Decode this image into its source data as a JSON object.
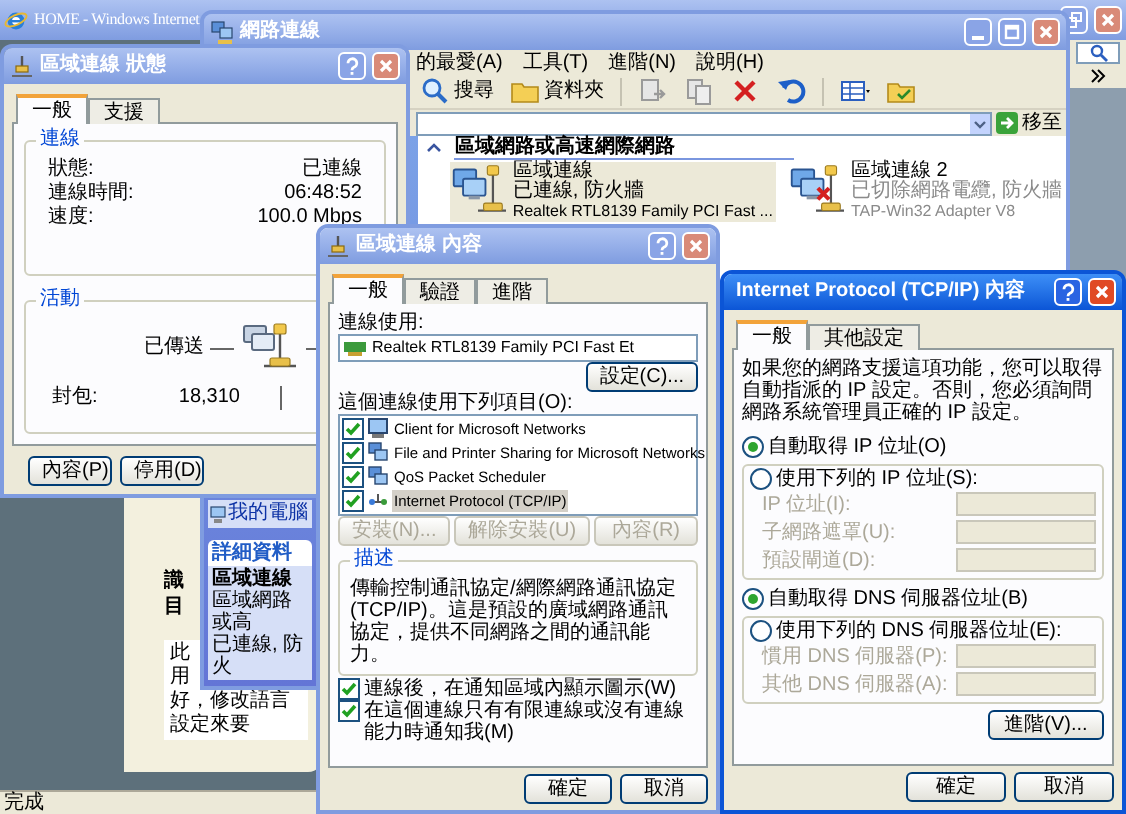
{
  "browser": {
    "title": "HOME - Windows Internet",
    "active": false,
    "status": "完成",
    "page": {
      "heading": "識",
      "subheading": "目",
      "lines": [
        "此",
        "用",
        "好，修改語言設定來要"
      ]
    }
  },
  "network_window": {
    "title": "網路連線",
    "active": false,
    "menu": [
      "的最愛(A)",
      "工具(T)",
      "進階(N)",
      "說明(H)"
    ],
    "toolbar": [
      {
        "kind": "search",
        "label": "搜尋"
      },
      {
        "kind": "folders",
        "label": "資料夾"
      },
      {
        "kind": "move"
      },
      {
        "kind": "copy"
      },
      {
        "kind": "delete"
      },
      {
        "kind": "undo"
      },
      {
        "kind": "views"
      },
      {
        "kind": "folder"
      }
    ],
    "go_button": "移至",
    "sidebar": {
      "places": [
        "我的電腦"
      ],
      "details_title": "詳細資料",
      "details_name": "區域連線",
      "details_lines": [
        "區域網路或高",
        "已連線, 防火"
      ]
    },
    "section_title": "區域網路或高速網際網路",
    "connections": [
      {
        "name": "區域連線",
        "status": "已連線, 防火牆",
        "device": "Realtek RTL8139 Family PCI Fast ...",
        "selected": true,
        "disconnected": false
      },
      {
        "name": "區域連線 2",
        "status": "已切除網路電纜, 防火牆",
        "device": "TAP-Win32 Adapter V8",
        "selected": false,
        "disconnected": true
      }
    ]
  },
  "status_window": {
    "title": "區域連線 狀態",
    "active": false,
    "tabs": [
      {
        "label": "一般",
        "selected": true
      },
      {
        "label": "支援",
        "selected": false
      }
    ],
    "connection_title": "連線",
    "rows": [
      {
        "label": "狀態:",
        "value": "已連線"
      },
      {
        "label": "連線時間:",
        "value": "06:48:52"
      },
      {
        "label": "速度:",
        "value": "100.0 Mbps"
      }
    ],
    "activity_title": "活動",
    "sent_label": "已傳送",
    "packets_label": "封包:",
    "packets_sent": "18,310",
    "buttons": [
      "內容(P)",
      "停用(D)"
    ]
  },
  "properties_window": {
    "title": "區域連線 內容",
    "active": false,
    "tabs": [
      {
        "label": "一般",
        "selected": true
      },
      {
        "label": "驗證",
        "selected": false
      },
      {
        "label": "進階",
        "selected": false
      }
    ],
    "connect_using": "連線使用:",
    "adapter": "Realtek RTL8139 Family PCI Fast Et",
    "configure_button": "設定(C)...",
    "items_label": "這個連線使用下列項目(O):",
    "items": [
      {
        "kind": "client",
        "label": "Client for Microsoft Networks",
        "checked": true,
        "selected": false
      },
      {
        "kind": "service",
        "label": "File and Printer Sharing for Microsoft Networks",
        "checked": true,
        "selected": false
      },
      {
        "kind": "service",
        "label": "QoS Packet Scheduler",
        "checked": true,
        "selected": false
      },
      {
        "kind": "protocol",
        "label": "Internet Protocol (TCP/IP)",
        "checked": true,
        "selected": true
      }
    ],
    "item_buttons": [
      {
        "label": "安裝(N)...",
        "disabled": true
      },
      {
        "label": "解除安裝(U)",
        "disabled": true
      },
      {
        "label": "內容(R)",
        "disabled": true
      }
    ],
    "description_title": "描述",
    "description": "傳輸控制通訊協定/網際網路通訊協定 (TCP/IP)。這是預設的廣域網路通訊協定，提供不同網路之間的通訊能力。",
    "options": [
      {
        "label": "連線後，在通知區域內顯示圖示(W)",
        "checked": true
      },
      {
        "label": "在這個連線只有有限連線或沒有連線能力時通知我(M)",
        "checked": true
      }
    ],
    "buttons": [
      "確定",
      "取消"
    ]
  },
  "tcpip_window": {
    "title": "Internet Protocol (TCP/IP) 內容",
    "active": true,
    "tabs": [
      {
        "label": "一般",
        "selected": true
      },
      {
        "label": "其他設定",
        "selected": false
      }
    ],
    "intro": "如果您的網路支援這項功能，您可以取得自動指派的 IP 設定。否則，您必須詢問網路系統管理員正確的 IP 設定。",
    "ip_options": [
      {
        "label": "自動取得 IP 位址(O)",
        "selected": true
      },
      {
        "label": "使用下列的 IP 位址(S):",
        "selected": false
      }
    ],
    "ip_fields": [
      {
        "label": "IP 位址(I):",
        "disabled": true
      },
      {
        "label": "子網路遮罩(U):",
        "disabled": true
      },
      {
        "label": "預設閘道(D):",
        "disabled": true
      }
    ],
    "dns_options": [
      {
        "label": "自動取得 DNS 伺服器位址(B)",
        "selected": true
      },
      {
        "label": "使用下列的 DNS 伺服器位址(E):",
        "selected": false
      }
    ],
    "dns_fields": [
      {
        "label": "慣用 DNS 伺服器(P):",
        "disabled": true
      },
      {
        "label": "其他 DNS 伺服器(A):",
        "disabled": true
      }
    ],
    "advanced_button": "進階(V)...",
    "buttons": [
      "確定",
      "取消"
    ]
  }
}
